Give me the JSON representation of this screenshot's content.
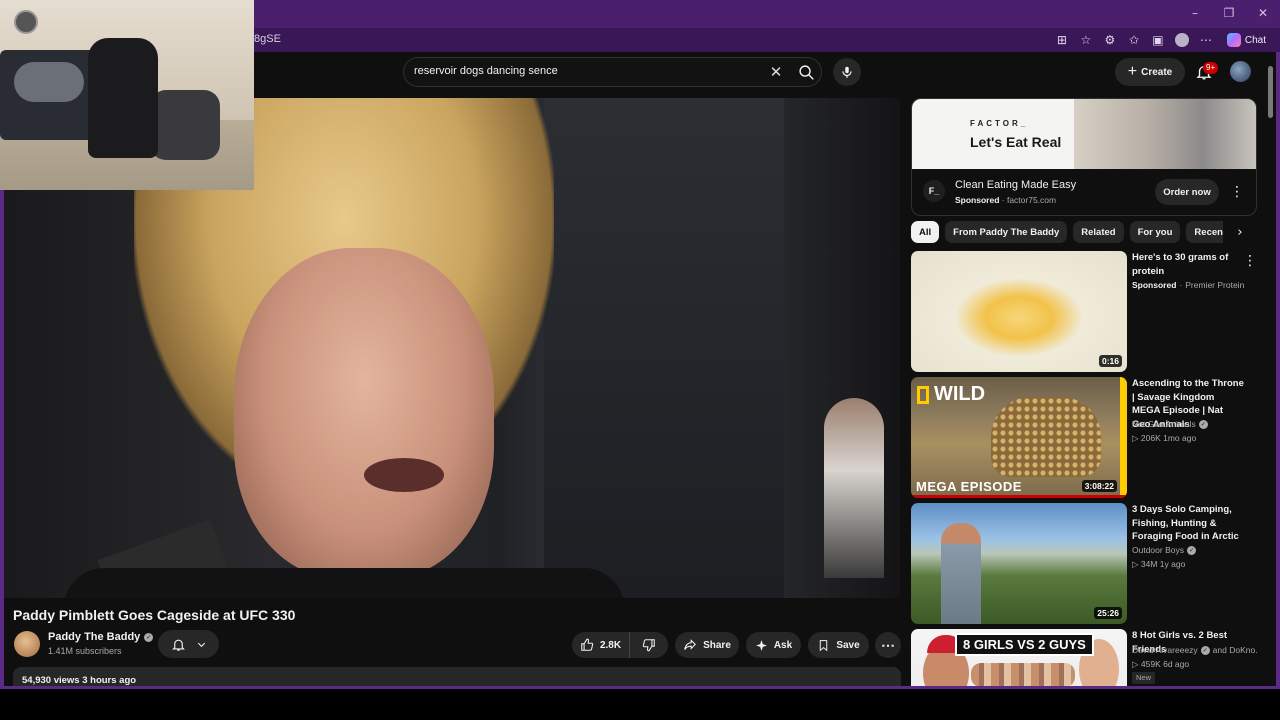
{
  "browser": {
    "url_fragment": "8gSE",
    "chat_label": "Chat",
    "window_controls": [
      "minimize-icon",
      "restore-icon",
      "close-icon"
    ]
  },
  "search": {
    "query": "reservoir dogs dancing sence"
  },
  "header": {
    "create_label": "Create",
    "notifications_badge": "9+"
  },
  "video": {
    "title": "Paddy Pimblett Goes Cageside at UFC 330",
    "channel": "Paddy The Baddy",
    "subscribers": "1.41M subscribers",
    "likes": "2.8K",
    "share_label": "Share",
    "ask_label": "Ask",
    "save_label": "Save",
    "views_date": "54,930 views  3 hours ago"
  },
  "ad": {
    "brand": "FACTOR_",
    "slogan": "Let's Eat Real",
    "logo_text": "F_",
    "title": "Clean Eating Made Easy",
    "sponsored": "Sponsored",
    "domain": "factor75.com",
    "cta": "Order now"
  },
  "chips": [
    "All",
    "From Paddy The Baddy",
    "Related",
    "For you",
    "Recently uploaded"
  ],
  "recommendations": [
    {
      "title": "Here's to 30 grams of protein",
      "sponsored": "Sponsored",
      "channel": "Premier Protein",
      "duration": "0:16"
    },
    {
      "title": "Ascending to the Throne | Savage Kingdom MEGA Episode | Nat Geo Animals",
      "channel": "Nat Geo Animals",
      "meta": "206K  1mo ago",
      "duration": "3:08:22",
      "thumb_text_1": "WILD",
      "thumb_text_2": "MEGA EPISODE"
    },
    {
      "title": "3 Days Solo Camping, Fishing, Hunting & Foraging Food in Arctic",
      "channel": "Outdoor Boys",
      "meta": "34M  1y ago",
      "duration": "25:26"
    },
    {
      "title": "8 Hot Girls vs. 2 Best Friends",
      "channel": "David Alvareeezy",
      "channel_extra": "and DoKno...",
      "meta": "459K  6d ago",
      "badge": "New",
      "thumb_text": "8 GIRLS VS 2 GUYS"
    }
  ],
  "colors": {
    "frame_purple": "#5b2a86",
    "accent_red": "#cc0000",
    "natgeo_yellow": "#ffcc00"
  }
}
